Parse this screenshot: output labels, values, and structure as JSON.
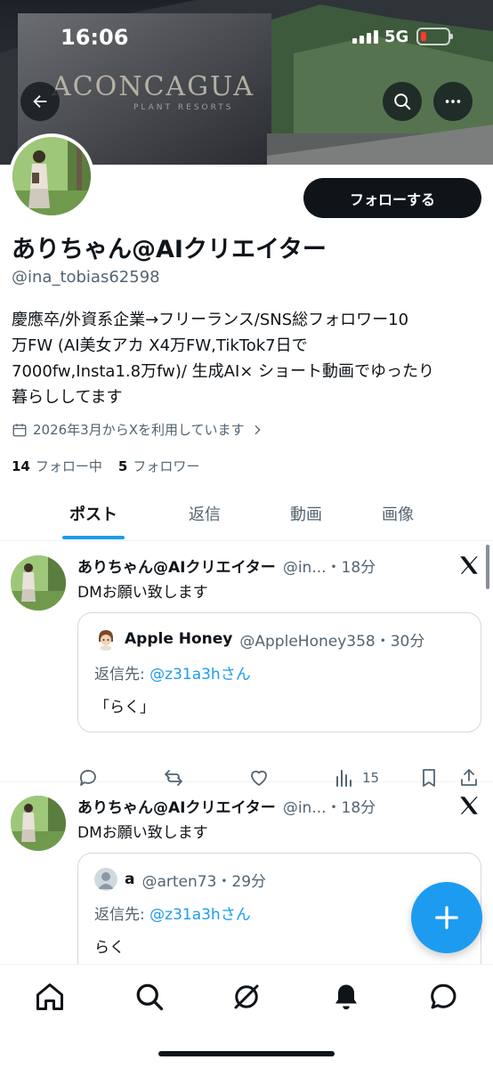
{
  "status_bar": {
    "time": "16:06",
    "network": "5G"
  },
  "banner": {
    "sign_text": "ACONCAGUA",
    "sign_subtext": "PLANT RESORTS"
  },
  "header": {
    "back_label": "back",
    "search_label": "search",
    "more_label": "more"
  },
  "profile": {
    "follow_button": "フォローする",
    "name": "ありちゃん@AIクリエイター",
    "handle": "@ina_tobias62598",
    "bio_lines": [
      "慶應卒/外資系企業→フリーランス/SNS総フォロワー10",
      "万FW (AI美女アカ X4万FW,TikTok7日で",
      "7000fw,Insta1.8万fw)/ 生成AI× ショート動画でゆったり",
      "暮らししてます"
    ],
    "joined": "2026年3月からXを利用しています",
    "following_count": "14",
    "following_label": "フォロー中",
    "followers_count": "5",
    "followers_label": "フォロワー"
  },
  "tabs": [
    "ポスト",
    "返信",
    "動画",
    "画像"
  ],
  "posts": [
    {
      "name": "ありちゃん@AIクリエイター",
      "meta": "@in...・18分",
      "text": "DMお願い致します",
      "quote": {
        "name": "Apple Honey",
        "meta": "@AppleHoney358・30分",
        "reply_prefix": "返信先: ",
        "reply_to": "@z31a3hさん",
        "text": "「らく」"
      },
      "views": "15"
    },
    {
      "name": "ありちゃん@AIクリエイター",
      "meta": "@in...・18分",
      "text": "DMお願い致します",
      "quote": {
        "name": "a",
        "meta": "@arten73・29分",
        "reply_prefix": "返信先: ",
        "reply_to": "@z31a3hさん",
        "text": "らく"
      }
    }
  ],
  "colors": {
    "accent": "#1d9bf0",
    "text": "#0f1419",
    "muted": "#536471"
  },
  "icons": [
    "back-arrow-icon",
    "search-icon",
    "more-icon",
    "calendar-icon",
    "chevron-right-icon",
    "x-logo-icon",
    "reply-icon",
    "repost-icon",
    "like-icon",
    "views-icon",
    "bookmark-icon",
    "share-icon",
    "compose-icon",
    "home-icon",
    "grok-icon",
    "notifications-icon",
    "messages-icon"
  ]
}
